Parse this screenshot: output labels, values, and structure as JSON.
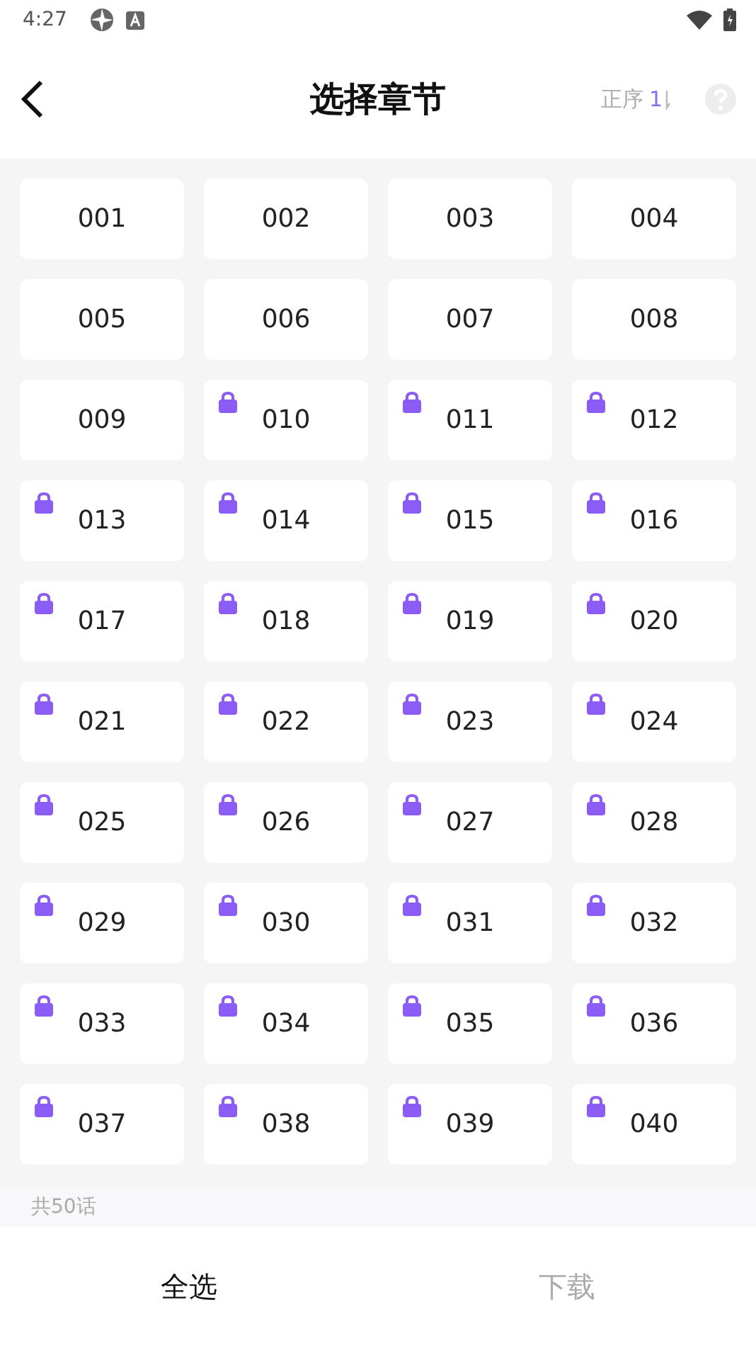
{
  "status_bar": {
    "time": "4:27"
  },
  "header": {
    "title": "选择章节",
    "sort_label": "正序",
    "sort_mark": "1"
  },
  "chapters": [
    {
      "label": "001",
      "locked": false
    },
    {
      "label": "002",
      "locked": false
    },
    {
      "label": "003",
      "locked": false
    },
    {
      "label": "004",
      "locked": false
    },
    {
      "label": "005",
      "locked": false
    },
    {
      "label": "006",
      "locked": false
    },
    {
      "label": "007",
      "locked": false
    },
    {
      "label": "008",
      "locked": false
    },
    {
      "label": "009",
      "locked": false
    },
    {
      "label": "010",
      "locked": true
    },
    {
      "label": "011",
      "locked": true
    },
    {
      "label": "012",
      "locked": true
    },
    {
      "label": "013",
      "locked": true
    },
    {
      "label": "014",
      "locked": true
    },
    {
      "label": "015",
      "locked": true
    },
    {
      "label": "016",
      "locked": true
    },
    {
      "label": "017",
      "locked": true
    },
    {
      "label": "018",
      "locked": true
    },
    {
      "label": "019",
      "locked": true
    },
    {
      "label": "020",
      "locked": true
    },
    {
      "label": "021",
      "locked": true
    },
    {
      "label": "022",
      "locked": true
    },
    {
      "label": "023",
      "locked": true
    },
    {
      "label": "024",
      "locked": true
    },
    {
      "label": "025",
      "locked": true
    },
    {
      "label": "026",
      "locked": true
    },
    {
      "label": "027",
      "locked": true
    },
    {
      "label": "028",
      "locked": true
    },
    {
      "label": "029",
      "locked": true
    },
    {
      "label": "030",
      "locked": true
    },
    {
      "label": "031",
      "locked": true
    },
    {
      "label": "032",
      "locked": true
    },
    {
      "label": "033",
      "locked": true
    },
    {
      "label": "034",
      "locked": true
    },
    {
      "label": "035",
      "locked": true
    },
    {
      "label": "036",
      "locked": true
    },
    {
      "label": "037",
      "locked": true
    },
    {
      "label": "038",
      "locked": true
    },
    {
      "label": "039",
      "locked": true
    },
    {
      "label": "040",
      "locked": true
    }
  ],
  "total": "共50话",
  "actions": [
    {
      "label": "全选",
      "disabled": false
    },
    {
      "label": "下载",
      "disabled": true
    }
  ]
}
